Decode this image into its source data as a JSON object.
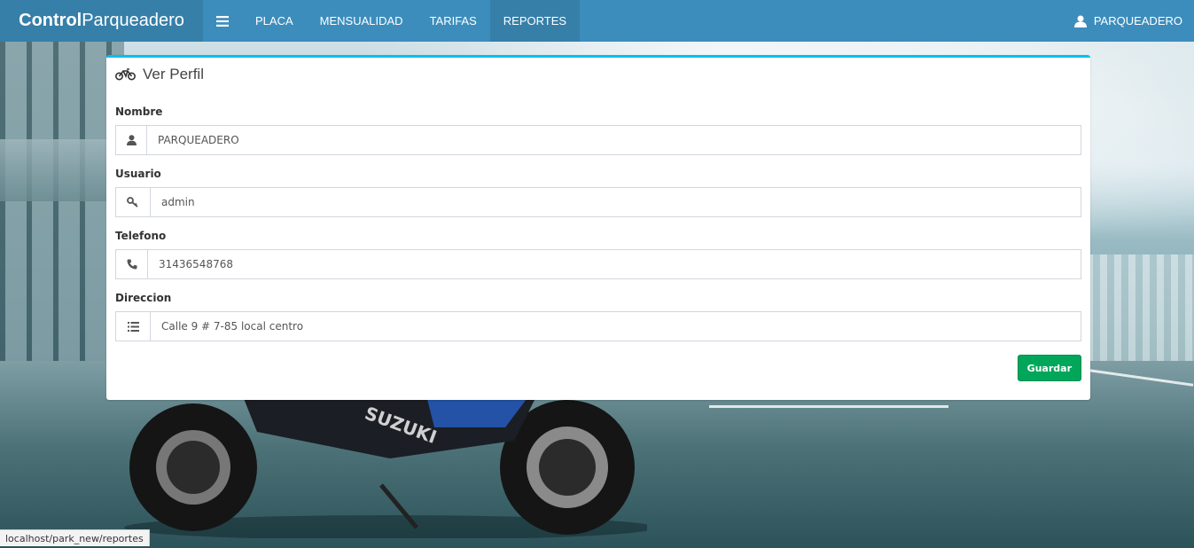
{
  "navbar": {
    "brand_bold": "Control",
    "brand_rest": "Parqueadero",
    "toggle_icon": "bars-icon",
    "items": [
      {
        "label": "PLACA"
      },
      {
        "label": "MENSUALIDAD"
      },
      {
        "label": "TARIFAS"
      },
      {
        "label": "REPORTES"
      }
    ],
    "user_label": "PARQUEADERO",
    "color": "#3c8dbc",
    "brand_color": "#367fa9"
  },
  "card": {
    "title": "Ver Perfil",
    "title_icon": "motorcycle-icon",
    "accent": "#00c0ef",
    "fields": {
      "nombre": {
        "label": "Nombre",
        "value": "PARQUEADERO",
        "icon": "user-icon"
      },
      "usuario": {
        "label": "Usuario",
        "value": "admin",
        "icon": "key-icon"
      },
      "telefono": {
        "label": "Telefono",
        "value": "31436548768",
        "icon": "phone-icon"
      },
      "direccion": {
        "label": "Direccion",
        "value": "Calle 9 # 7-85 local centro",
        "icon": "list-icon"
      }
    },
    "save_label": "Guardar",
    "save_color": "#00a65a"
  },
  "status_bar": {
    "url": "localhost/park_new/reportes"
  }
}
